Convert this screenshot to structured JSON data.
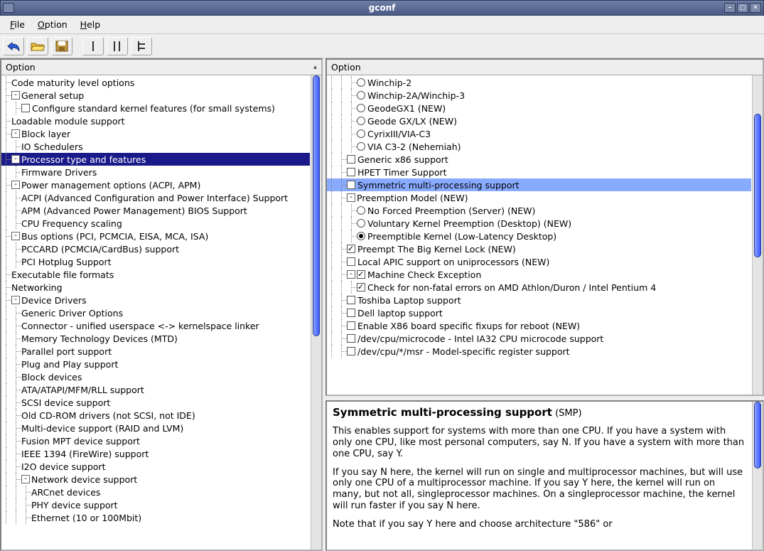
{
  "window": {
    "title": "gconf"
  },
  "menubar": {
    "file": "File",
    "option": "Option",
    "help": "Help"
  },
  "toolbar": {
    "back_icon": "undo-icon",
    "open_icon": "folder-open-icon",
    "save_icon": "save-icon",
    "single_icon": "single-view-icon",
    "split_icon": "split-view-icon",
    "full_icon": "full-view-icon"
  },
  "left_panel": {
    "header": "Option",
    "items": [
      {
        "d": 0,
        "exp": null,
        "t": "Code maturity level options"
      },
      {
        "d": 0,
        "exp": "-",
        "t": "General setup"
      },
      {
        "d": 1,
        "exp": null,
        "cb": false,
        "t": "Configure standard kernel features (for small systems)"
      },
      {
        "d": 0,
        "exp": null,
        "t": "Loadable module support"
      },
      {
        "d": 0,
        "exp": "-",
        "t": "Block layer"
      },
      {
        "d": 1,
        "exp": null,
        "t": "IO Schedulers"
      },
      {
        "d": 0,
        "exp": "-",
        "t": "Processor type and features",
        "sel": "dark"
      },
      {
        "d": 1,
        "exp": null,
        "t": "Firmware Drivers"
      },
      {
        "d": 0,
        "exp": "-",
        "t": "Power management options (ACPI, APM)"
      },
      {
        "d": 1,
        "exp": null,
        "t": "ACPI (Advanced Configuration and Power Interface) Support"
      },
      {
        "d": 1,
        "exp": null,
        "t": "APM (Advanced Power Management) BIOS Support"
      },
      {
        "d": 1,
        "exp": null,
        "t": "CPU Frequency scaling"
      },
      {
        "d": 0,
        "exp": "-",
        "t": "Bus options (PCI, PCMCIA, EISA, MCA, ISA)"
      },
      {
        "d": 1,
        "exp": null,
        "t": "PCCARD (PCMCIA/CardBus) support"
      },
      {
        "d": 1,
        "exp": null,
        "t": "PCI Hotplug Support"
      },
      {
        "d": 0,
        "exp": null,
        "t": "Executable file formats"
      },
      {
        "d": 0,
        "exp": null,
        "t": "Networking"
      },
      {
        "d": 0,
        "exp": "-",
        "t": "Device Drivers"
      },
      {
        "d": 1,
        "exp": null,
        "t": "Generic Driver Options"
      },
      {
        "d": 1,
        "exp": null,
        "t": "Connector - unified userspace <-> kernelspace linker"
      },
      {
        "d": 1,
        "exp": null,
        "t": "Memory Technology Devices (MTD)"
      },
      {
        "d": 1,
        "exp": null,
        "t": "Parallel port support"
      },
      {
        "d": 1,
        "exp": null,
        "t": "Plug and Play support"
      },
      {
        "d": 1,
        "exp": null,
        "t": "Block devices"
      },
      {
        "d": 1,
        "exp": null,
        "t": "ATA/ATAPI/MFM/RLL support"
      },
      {
        "d": 1,
        "exp": null,
        "t": "SCSI device support"
      },
      {
        "d": 1,
        "exp": null,
        "t": "Old CD-ROM drivers (not SCSI, not IDE)"
      },
      {
        "d": 1,
        "exp": null,
        "t": "Multi-device support (RAID and LVM)"
      },
      {
        "d": 1,
        "exp": null,
        "t": "Fusion MPT device support"
      },
      {
        "d": 1,
        "exp": null,
        "t": "IEEE 1394 (FireWire) support"
      },
      {
        "d": 1,
        "exp": null,
        "t": "I2O device support"
      },
      {
        "d": 1,
        "exp": "-",
        "t": "Network device support"
      },
      {
        "d": 2,
        "exp": null,
        "t": "ARCnet devices"
      },
      {
        "d": 2,
        "exp": null,
        "t": "PHY device support"
      },
      {
        "d": 2,
        "exp": null,
        "t": "Ethernet (10 or 100Mbit)"
      }
    ]
  },
  "right_panel": {
    "header": "Option",
    "items": [
      {
        "d": 2,
        "radio": false,
        "t": "Winchip-2"
      },
      {
        "d": 2,
        "radio": false,
        "t": "Winchip-2A/Winchip-3"
      },
      {
        "d": 2,
        "radio": false,
        "t": "GeodeGX1 (NEW)"
      },
      {
        "d": 2,
        "radio": false,
        "t": "Geode GX/LX (NEW)"
      },
      {
        "d": 2,
        "radio": false,
        "t": "CyrixIII/VIA-C3"
      },
      {
        "d": 2,
        "radio": false,
        "t": "VIA C3-2 (Nehemiah)"
      },
      {
        "d": 1,
        "cb": false,
        "t": "Generic x86 support"
      },
      {
        "d": 1,
        "cb": false,
        "t": "HPET Timer Support"
      },
      {
        "d": 1,
        "cb": false,
        "t": "Symmetric multi-processing support",
        "sel": "light"
      },
      {
        "d": 1,
        "exp": "-",
        "t": "Preemption Model (NEW)"
      },
      {
        "d": 2,
        "radio": false,
        "t": "No Forced Preemption (Server) (NEW)"
      },
      {
        "d": 2,
        "radio": false,
        "t": "Voluntary Kernel Preemption (Desktop) (NEW)"
      },
      {
        "d": 2,
        "radio": true,
        "t": "Preemptible Kernel (Low-Latency Desktop)"
      },
      {
        "d": 1,
        "cb": true,
        "t": "Preempt The Big Kernel Lock (NEW)"
      },
      {
        "d": 1,
        "cb": false,
        "t": "Local APIC support on uniprocessors (NEW)"
      },
      {
        "d": 1,
        "exp": "-",
        "cb": true,
        "t": "Machine Check Exception"
      },
      {
        "d": 2,
        "cb": true,
        "t": "Check for non-fatal errors on AMD Athlon/Duron / Intel Pentium 4"
      },
      {
        "d": 1,
        "cb": false,
        "t": "Toshiba Laptop support"
      },
      {
        "d": 1,
        "cb": false,
        "t": "Dell laptop support"
      },
      {
        "d": 1,
        "cb": false,
        "t": "Enable X86 board specific fixups for reboot (NEW)"
      },
      {
        "d": 1,
        "cb": false,
        "t": "/dev/cpu/microcode - Intel IA32 CPU microcode support"
      },
      {
        "d": 1,
        "cb": false,
        "t": "/dev/cpu/*/msr - Model-specific register support"
      }
    ]
  },
  "help": {
    "title": "Symmetric multi-processing support",
    "abbr": "(SMP)",
    "para1": "This enables support for systems with more than one CPU. If you have a system with only one CPU, like most personal computers, say N. If you have a system with more than one CPU, say Y.",
    "para2": "If you say N here, the kernel will run on single and multiprocessor machines, but will use only one CPU of a multiprocessor machine. If you say Y here, the kernel will run on many, but not all, singleprocessor machines. On a singleprocessor machine, the kernel will run faster if you say N here.",
    "para3": "Note that if you say Y here and choose architecture \"586\" or"
  }
}
